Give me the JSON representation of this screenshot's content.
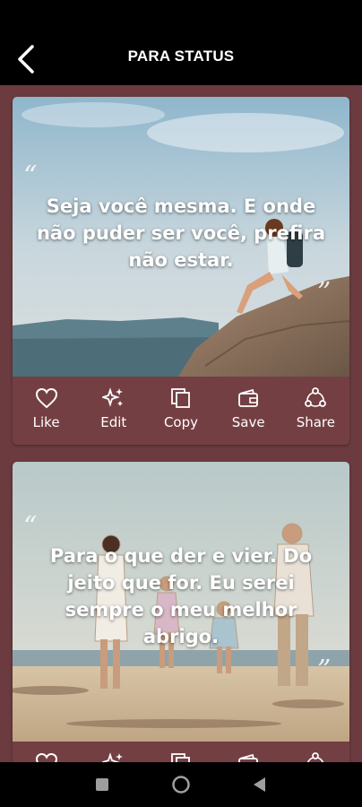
{
  "header": {
    "title": "PARA STATUS",
    "back_icon": "arrow-left-icon"
  },
  "cards": [
    {
      "quote": "Seja você mesma. E onde não puder ser você, prefira não estar.",
      "open_mark": "“",
      "close_mark": "”"
    },
    {
      "quote": "Para o que der e vier. Do jeito que for. Eu serei sempre o meu melhor abrigo.",
      "open_mark": "“",
      "close_mark": "”"
    }
  ],
  "actions": [
    {
      "label": "Like",
      "icon": "heart-icon"
    },
    {
      "label": "Edit",
      "icon": "sparkle-icon"
    },
    {
      "label": "Copy",
      "icon": "copy-icon"
    },
    {
      "label": "Save",
      "icon": "wallet-icon"
    },
    {
      "label": "Share",
      "icon": "share-icon"
    }
  ],
  "navbar": {
    "items": [
      "recents-square-icon",
      "home-circle-icon",
      "back-triangle-icon"
    ]
  },
  "colors": {
    "background": "#6b3b3f",
    "appbar": "#000000",
    "card": "#743f43",
    "text": "#ffffff"
  }
}
